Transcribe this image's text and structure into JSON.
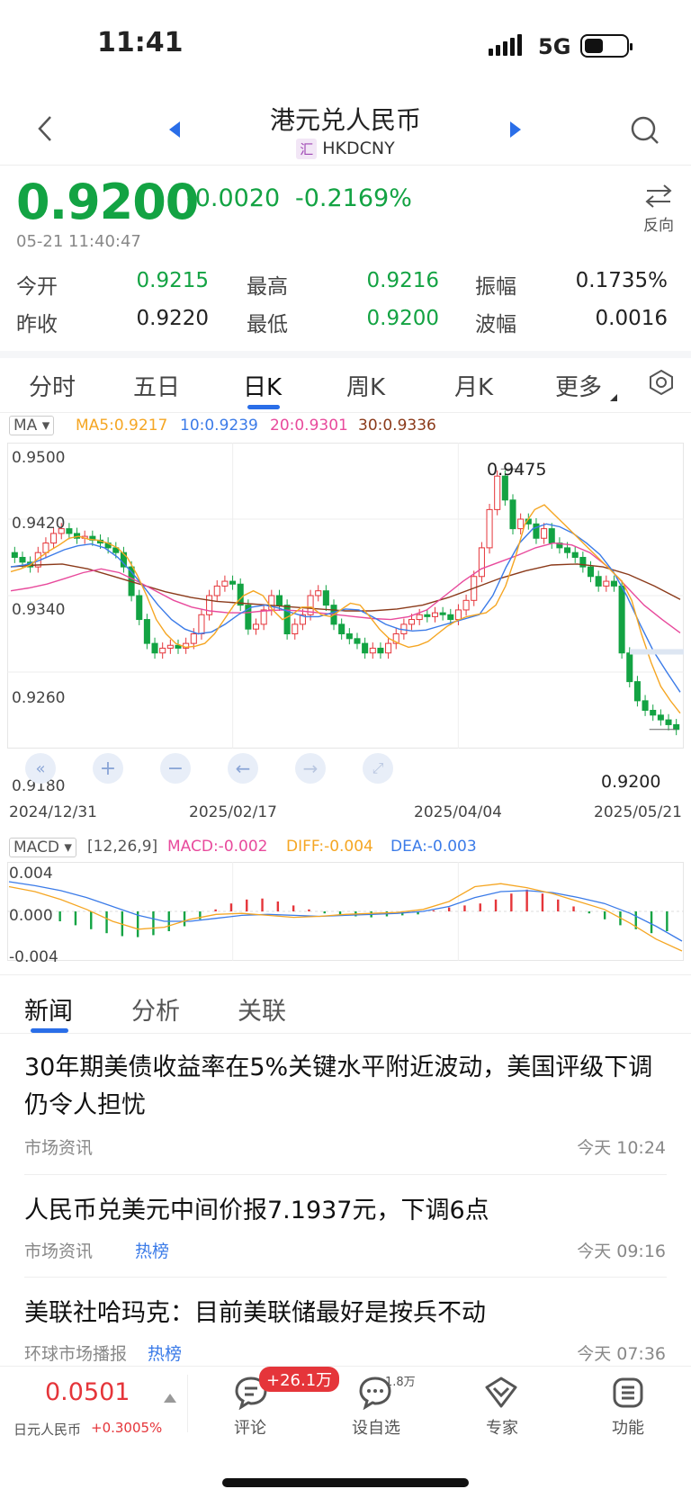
{
  "status": {
    "time": "11:41",
    "network": "5G"
  },
  "header": {
    "title": "港元兑人民币",
    "tag": "汇",
    "code": "HKDCNY"
  },
  "quote": {
    "price": "0.9200",
    "change": "-0.0020",
    "change_pct": "-0.2169%",
    "datetime": "05-21 11:40:47",
    "reverse_label": "反向",
    "stats": {
      "open_label": "今开",
      "open": "0.9215",
      "high_label": "最高",
      "high": "0.9216",
      "amplitude_label": "振幅",
      "amplitude": "0.1735%",
      "prev_close_label": "昨收",
      "prev_close": "0.9220",
      "low_label": "最低",
      "low": "0.9200",
      "range_label": "波幅",
      "range": "0.0016"
    }
  },
  "period_tabs": [
    "分时",
    "五日",
    "日K",
    "周K",
    "月K",
    "更多"
  ],
  "active_tab": "日K",
  "ma_legend": {
    "selector": "MA",
    "ma5": "MA5:0.9217",
    "ma10": "10:0.9239",
    "ma20": "20:0.9301",
    "ma30": "30:0.9336"
  },
  "macd_legend": {
    "selector": "MACD",
    "params": "[12,26,9]",
    "macd": "MACD:-0.002",
    "diff": "DIFF:-0.004",
    "dea": "DEA:-0.003"
  },
  "colors": {
    "up": "#e5353a",
    "down": "#13a343",
    "ma5": "#f5a623",
    "ma10": "#3b7be8",
    "ma20": "#e84a9c",
    "ma30": "#8b3a1a",
    "accent": "#2a6ee8"
  },
  "chart_data": [
    {
      "type": "candlestick",
      "ylim": [
        0.918,
        0.95
      ],
      "yticks": [
        "0.9500",
        "0.9420",
        "0.9340",
        "0.9260",
        "0.9180"
      ],
      "xticks": [
        "2024/12/31",
        "2025/02/17",
        "2025/04/04",
        "2025/05/21"
      ],
      "annotations": {
        "max": "0.9475",
        "last": "0.9200"
      },
      "close": [
        0.938,
        0.9375,
        0.937,
        0.9385,
        0.9395,
        0.9405,
        0.941,
        0.9405,
        0.94,
        0.9402,
        0.9398,
        0.9395,
        0.939,
        0.9385,
        0.937,
        0.934,
        0.9315,
        0.929,
        0.928,
        0.9285,
        0.9288,
        0.9285,
        0.929,
        0.93,
        0.932,
        0.934,
        0.935,
        0.9355,
        0.9352,
        0.933,
        0.9305,
        0.931,
        0.9325,
        0.934,
        0.933,
        0.93,
        0.931,
        0.932,
        0.934,
        0.9345,
        0.933,
        0.931,
        0.93,
        0.9295,
        0.929,
        0.928,
        0.9285,
        0.928,
        0.929,
        0.93,
        0.931,
        0.9315,
        0.932,
        0.9318,
        0.9322,
        0.932,
        0.9315,
        0.9325,
        0.9335,
        0.936,
        0.939,
        0.943,
        0.9465,
        0.944,
        0.941,
        0.942,
        0.9415,
        0.94,
        0.941,
        0.9395,
        0.939,
        0.9385,
        0.938,
        0.937,
        0.936,
        0.935,
        0.9355,
        0.935,
        0.928,
        0.925,
        0.923,
        0.922,
        0.9215,
        0.921,
        0.9205,
        0.92
      ],
      "ma5": [
        0.9365,
        0.9368,
        0.9372,
        0.938,
        0.9387,
        0.9393,
        0.94,
        0.9402,
        0.9399,
        0.9398,
        0.9395,
        0.939,
        0.938,
        0.9362,
        0.934,
        0.9315,
        0.93,
        0.929,
        0.9286,
        0.9287,
        0.929,
        0.93,
        0.9315,
        0.933,
        0.934,
        0.9345,
        0.934,
        0.9325,
        0.9315,
        0.932,
        0.9328,
        0.9328,
        0.932,
        0.9318,
        0.9325,
        0.9332,
        0.933,
        0.9318,
        0.9305,
        0.9295,
        0.929,
        0.9286,
        0.9288,
        0.9292,
        0.93,
        0.9308,
        0.9314,
        0.9318,
        0.932,
        0.9322,
        0.933,
        0.935,
        0.938,
        0.9415,
        0.943,
        0.9435,
        0.9425,
        0.9415,
        0.9405,
        0.9395,
        0.9385,
        0.9375,
        0.9365,
        0.9355,
        0.9335,
        0.93,
        0.927,
        0.9245,
        0.923,
        0.9217
      ],
      "ma10": [
        0.937,
        0.9372,
        0.9376,
        0.9382,
        0.9388,
        0.9392,
        0.9394,
        0.939,
        0.938,
        0.9365,
        0.9348,
        0.933,
        0.9315,
        0.9305,
        0.93,
        0.9302,
        0.931,
        0.932,
        0.9328,
        0.933,
        0.9327,
        0.9322,
        0.9318,
        0.9318,
        0.9322,
        0.9326,
        0.9325,
        0.9318,
        0.931,
        0.9305,
        0.9303,
        0.9304,
        0.9308,
        0.9312,
        0.9316,
        0.932,
        0.934,
        0.937,
        0.9395,
        0.941,
        0.9415,
        0.9412,
        0.9405,
        0.9395,
        0.9383,
        0.9365,
        0.934,
        0.931,
        0.9282,
        0.926,
        0.9239
      ],
      "ma20": [
        0.9345,
        0.9348,
        0.9352,
        0.9358,
        0.9364,
        0.9368,
        0.9364,
        0.9355,
        0.9345,
        0.9335,
        0.9328,
        0.9324,
        0.9322,
        0.9322,
        0.9324,
        0.9325,
        0.9324,
        0.9322,
        0.932,
        0.9318,
        0.9316,
        0.9315,
        0.9318,
        0.9325,
        0.934,
        0.9355,
        0.9368,
        0.9375,
        0.9382,
        0.939,
        0.9395,
        0.9393,
        0.9385,
        0.937,
        0.935,
        0.933,
        0.9315,
        0.9301
      ],
      "ma30": [
        0.937,
        0.9372,
        0.9373,
        0.9368,
        0.936,
        0.9352,
        0.9344,
        0.9338,
        0.9334,
        0.9332,
        0.933,
        0.9328,
        0.9326,
        0.9324,
        0.9324,
        0.9326,
        0.933,
        0.9338,
        0.9348,
        0.9358,
        0.9366,
        0.9372,
        0.9373,
        0.937,
        0.9362,
        0.935,
        0.9336
      ]
    },
    {
      "type": "bar",
      "name": "MACD",
      "ylim": [
        -0.005,
        0.005
      ],
      "yticks": [
        "0.004",
        "0.000",
        "-0.004"
      ],
      "macd": [
        -0.001,
        -0.0014,
        -0.0018,
        -0.0022,
        -0.0025,
        -0.0026,
        -0.0024,
        -0.002,
        -0.0015,
        -0.0008,
        0.0002,
        0.0008,
        0.0012,
        0.0013,
        0.001,
        0.0006,
        0.0002,
        -0.0002,
        -0.0004,
        -0.0005,
        -0.0006,
        -0.0005,
        -0.0004,
        -0.0003,
        0.0001,
        0.0004,
        0.0006,
        0.0008,
        0.0012,
        0.0018,
        0.0022,
        0.0018,
        0.0012,
        0.0005,
        -0.0002,
        -0.0008,
        -0.0014,
        -0.0018,
        -0.0022,
        -0.002
      ],
      "diff": [
        0.0025,
        0.002,
        0.0012,
        0.0002,
        -0.001,
        -0.0018,
        -0.0016,
        -0.0008,
        -0.0003,
        -0.0002,
        -0.0004,
        -0.0006,
        -0.0005,
        -0.0003,
        -0.0002,
        -0.0001,
        0.0002,
        0.001,
        0.0025,
        0.0028,
        0.0024,
        0.0018,
        0.001,
        0.0002,
        -0.0012,
        -0.0028,
        -0.004
      ],
      "dea": [
        0.003,
        0.0026,
        0.0021,
        0.0014,
        0.0005,
        -0.0004,
        -0.001,
        -0.001,
        -0.0007,
        -0.0004,
        -0.0003,
        -0.0004,
        -0.0005,
        -0.0004,
        -0.0003,
        -0.0002,
        0.0,
        0.0005,
        0.0014,
        0.002,
        0.0021,
        0.0019,
        0.0014,
        0.0008,
        -0.0002,
        -0.0015,
        -0.003
      ]
    }
  ],
  "news_tabs": [
    "新闻",
    "分析",
    "关联"
  ],
  "news": [
    {
      "title": "30年期美债收益率在5%关键水平附近波动，美国评级下调仍令人担忧",
      "source": "市场资讯",
      "tag": "",
      "time": "今天 10:24"
    },
    {
      "title": "人民币兑美元中间价报7.1937元，下调6点",
      "source": "市场资讯",
      "tag": "热榜",
      "time": "今天 09:16"
    },
    {
      "title": "美联社哈玛克：目前美联储最好是按兵不动",
      "source": "环球市场播报",
      "tag": "热榜",
      "time": "今天 07:36"
    }
  ],
  "bottom_bar": {
    "quote_value": "0.0501",
    "quote_name": "日元人民币",
    "quote_change": "+0.3005%",
    "comment_label": "评论",
    "comment_badge": "+26.1万",
    "watch_label": "设自选",
    "watch_count": "1.8万",
    "expert_label": "专家",
    "func_label": "功能"
  }
}
